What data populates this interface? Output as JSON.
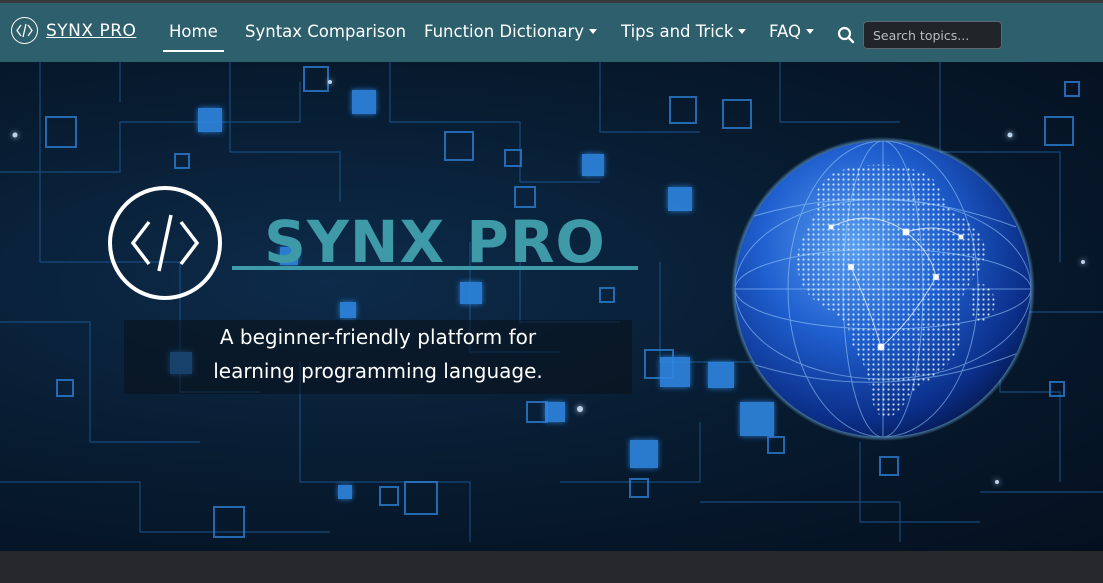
{
  "navbar": {
    "brand": "SYNX PRO",
    "links": [
      {
        "label": "Home",
        "active": true,
        "dropdown": false
      },
      {
        "label": "Syntax Comparison",
        "active": false,
        "dropdown": false
      },
      {
        "label": "Function Dictionary",
        "active": false,
        "dropdown": true
      },
      {
        "label": "Tips and Trick",
        "active": false,
        "dropdown": true
      },
      {
        "label": "FAQ",
        "active": false,
        "dropdown": true
      }
    ],
    "search_placeholder": "Search topics..."
  },
  "hero": {
    "title": "SYNX PRO",
    "tagline_line1": "A beginner-friendly platform for",
    "tagline_line2": "learning programming language."
  },
  "colors": {
    "navbar_bg": "#2d5f6c",
    "accent": "#3e9aa6",
    "hero_bg": "#071a2e",
    "page_bg": "#26282b"
  },
  "icons": [
    "code-brackets-icon",
    "search-icon",
    "caret-down-icon",
    "globe-image"
  ]
}
